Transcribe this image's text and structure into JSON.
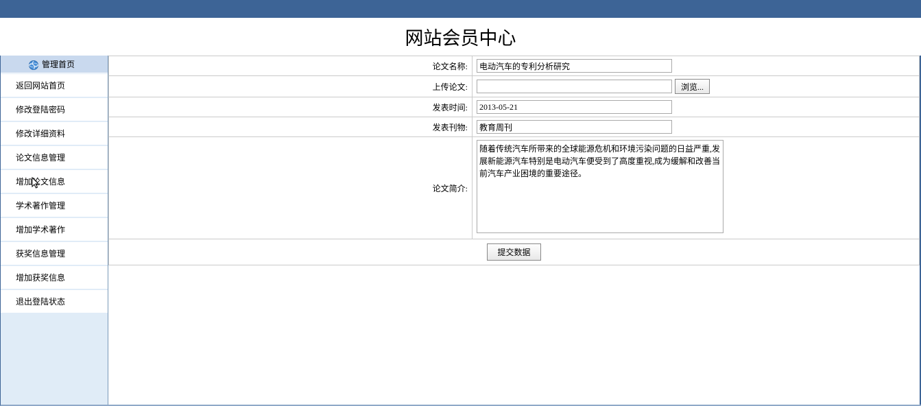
{
  "header": {
    "title": "网站会员中心"
  },
  "sidebar": {
    "header_label": "管理首页",
    "items": [
      {
        "label": "返回网站首页"
      },
      {
        "label": "修改登陆密码"
      },
      {
        "label": "修改详细资料"
      },
      {
        "label": "论文信息管理"
      },
      {
        "label": "增加论文信息"
      },
      {
        "label": "学术著作管理"
      },
      {
        "label": "增加学术著作"
      },
      {
        "label": "获奖信息管理"
      },
      {
        "label": "增加获奖信息"
      },
      {
        "label": "退出登陆状态"
      }
    ]
  },
  "form": {
    "fields": {
      "paper_name": {
        "label": "论文名称:",
        "value": "电动汽车的专利分析研究"
      },
      "upload": {
        "label": "上传论文:",
        "value": "",
        "browse_label": "浏览..."
      },
      "publish_date": {
        "label": "发表时间:",
        "value": "2013-05-21"
      },
      "journal": {
        "label": "发表刊物:",
        "value": "教育周刊"
      },
      "summary": {
        "label": "论文简介:",
        "value": "随着传统汽车所带来的全球能源危机和环境污染问题的日益严重,发展新能源汽车特别是电动汽车便受到了高度重视,成为缓解和改善当前汽车产业困境的重要途径。"
      }
    },
    "submit_label": "提交数据"
  }
}
